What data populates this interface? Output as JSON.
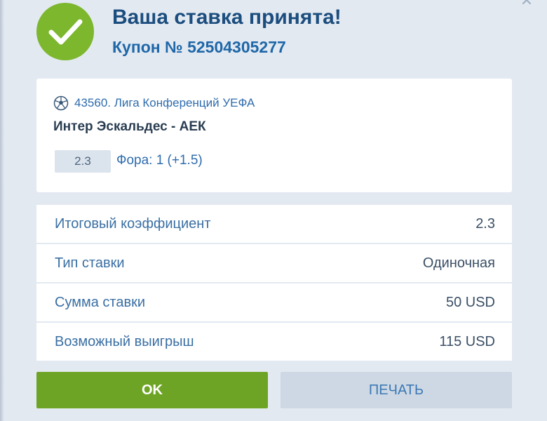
{
  "header": {
    "title": "Ваша ставка принята!",
    "coupon": "Купон № 52504305277"
  },
  "event": {
    "league": "43560. Лига Конференций УЕФА",
    "sport_icon": "soccer-ball-icon",
    "match": "Интер Эскальдес - АЕК",
    "odds": "2.3",
    "bet": "Фора: 1 (+1.5)"
  },
  "summary": [
    {
      "label": "Итоговый коэффициент",
      "value": "2.3"
    },
    {
      "label": "Тип ставки",
      "value": "Одиночная"
    },
    {
      "label": "Сумма ставки",
      "value": "50 USD"
    },
    {
      "label": "Возможный выигрыш",
      "value": "115 USD"
    }
  ],
  "buttons": {
    "ok": "OK",
    "print": "ПЕЧАТЬ"
  },
  "colors": {
    "accent_green": "#6ea425",
    "title_blue": "#1b4d7e",
    "link_blue": "#2f6cae",
    "background": "#e3e9f1"
  }
}
